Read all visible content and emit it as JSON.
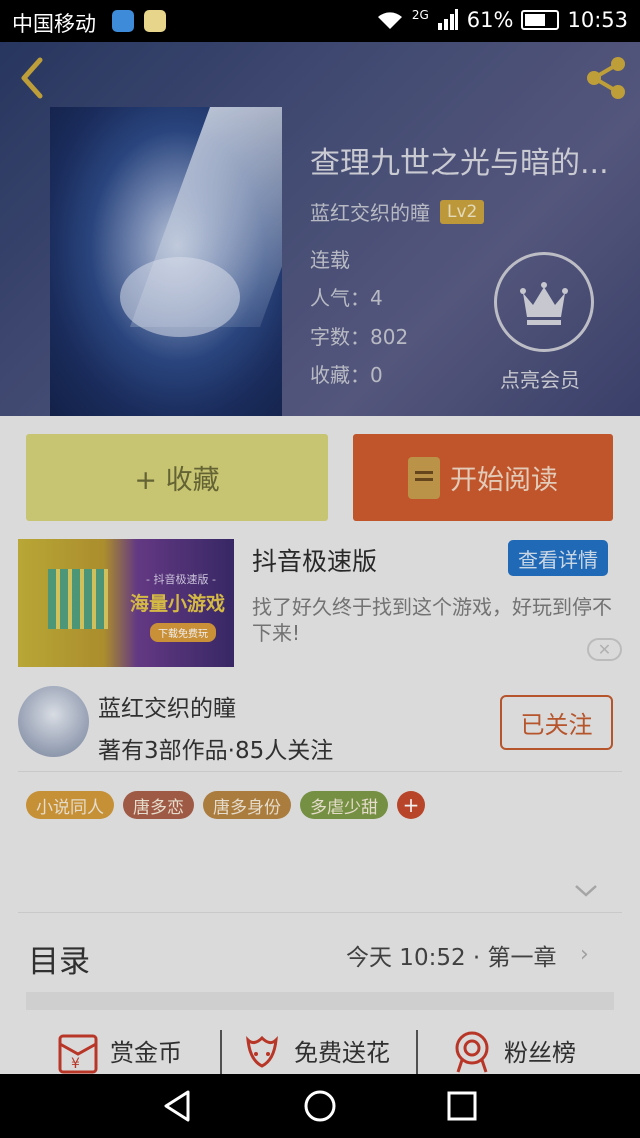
{
  "status_bar": {
    "carrier": "中国移动",
    "network": "2G",
    "battery": "61%",
    "time": "10:53"
  },
  "book": {
    "title": "查理九世之光与暗的...",
    "author": "蓝红交织的瞳",
    "level": "Lv2",
    "status": "连载",
    "popularity": "人气：4",
    "word_count": "字数：802",
    "favorites": "收藏：0",
    "vip_label": "点亮会员"
  },
  "actions": {
    "collect": "+ 收藏",
    "read": "开始阅读"
  },
  "ad": {
    "title": "抖音极速版",
    "button": "查看详情",
    "description": "找了好久终于找到这个游戏，好玩到停不下来!",
    "close": "✕",
    "image_text": "海量小游戏",
    "image_sub": "- 抖音极速版 -",
    "image_btn": "下载免费玩"
  },
  "author_card": {
    "name": "蓝红交织的瞳",
    "stats": "著有3部作品·85人关注",
    "follow": "已关注"
  },
  "tags": [
    {
      "label": "小说同人",
      "color": "#d29a3a"
    },
    {
      "label": "唐多恋",
      "color": "#a8604a"
    },
    {
      "label": "唐多身份",
      "color": "#b58442"
    },
    {
      "label": "多虐少甜",
      "color": "#7d9a48"
    }
  ],
  "tag_add": "+",
  "catalog": {
    "label": "目录",
    "latest": "今天 10:52 · 第一章",
    "chevron": "›"
  },
  "bottom_actions": [
    {
      "label": "赏金币",
      "icon": "red-envelope-icon"
    },
    {
      "label": "免费送花",
      "icon": "flower-icon"
    },
    {
      "label": "粉丝榜",
      "icon": "medal-icon"
    }
  ]
}
